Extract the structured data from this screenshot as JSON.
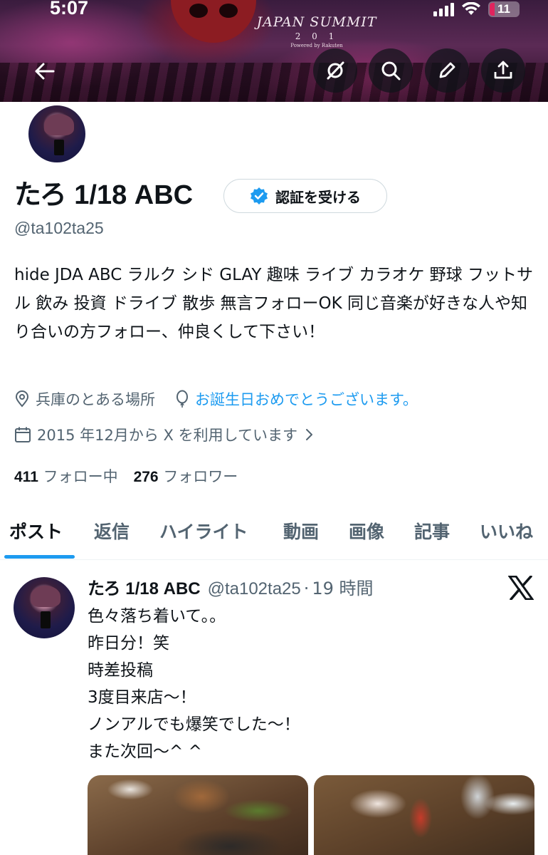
{
  "status_bar": {
    "time": "5:07",
    "battery_level": "11",
    "battery_color": "#e0245e"
  },
  "banner": {
    "logo_text_line1": "JAPAN SUMMIT",
    "logo_text_year": "2 0 1",
    "logo_powered": "Powered by Rakuten"
  },
  "header_actions": {
    "back_icon": "arrow-left-icon",
    "grok_icon": "grok-icon",
    "search_icon": "search-icon",
    "edit_icon": "pencil-icon",
    "share_icon": "share-icon"
  },
  "profile": {
    "display_name": "たろ 1/18 ABC",
    "verify_label": "認証を受ける",
    "handle": "@ta102ta25",
    "bio": "hide JDA ABC ラルク シド GLAY 趣味 ライブ カラオケ 野球 フットサル 飲み 投資 ドライブ 散歩 無言フォローOK 同じ音楽が好きな人や知り合いの方フォロー、仲良くして下さい！",
    "location": "兵庫のとある場所",
    "birthday_text": "お誕生日おめでとうございます。",
    "joined": "2015 年12月から X を利用しています",
    "following_count": "411",
    "following_label": "フォロー中",
    "followers_count": "276",
    "followers_label": "フォロワー"
  },
  "tabs": [
    {
      "label": "ポスト",
      "active": true
    },
    {
      "label": "返信",
      "active": false
    },
    {
      "label": "ハイライト",
      "active": false
    },
    {
      "label": "動画",
      "active": false
    },
    {
      "label": "画像",
      "active": false
    },
    {
      "label": "記事",
      "active": false
    },
    {
      "label": "いいね",
      "active": false
    }
  ],
  "post": {
    "author_name": "たろ 1/18 ABC",
    "author_handle": "@ta102ta25",
    "separator": "·",
    "time": "19 時間",
    "lines": [
      "色々落ち着いて。。",
      "昨日分！笑",
      "時差投稿",
      "3度目来店〜！",
      "ノンアルでも爆笑でした〜！",
      "また次回〜^ ^"
    ]
  },
  "colors": {
    "accent": "#1d9bf0",
    "text_primary": "#0f1419",
    "text_secondary": "#536471",
    "border": "#cfd9de"
  }
}
